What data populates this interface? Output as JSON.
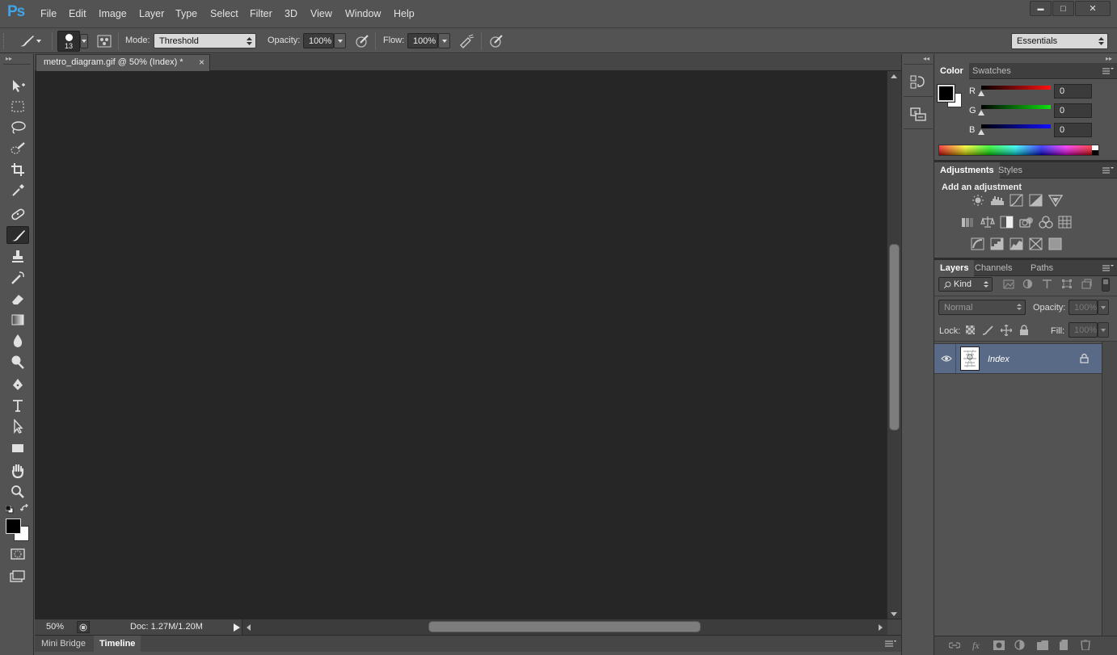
{
  "app": {
    "logo": "Ps"
  },
  "menu": [
    "File",
    "Edit",
    "Image",
    "Layer",
    "Type",
    "Select",
    "Filter",
    "3D",
    "View",
    "Window",
    "Help"
  ],
  "window_controls": {
    "minimize": "▬",
    "maximize": "□",
    "close": "✕"
  },
  "options": {
    "brush_size": "13",
    "mode_label": "Mode:",
    "mode_value": "Threshold",
    "opacity_label": "Opacity:",
    "opacity_value": "100%",
    "flow_label": "Flow:",
    "flow_value": "100%",
    "workspace": "Essentials"
  },
  "document": {
    "tab_title": "metro_diagram.gif @ 50% (Index) *",
    "tab_close": "×",
    "zoom": "50%",
    "doc_info": "Doc: 1.27M/1.20M"
  },
  "bottom_tabs": [
    "Mini Bridge",
    "Timeline"
  ],
  "color_panel": {
    "tabs": [
      "Color",
      "Swatches"
    ],
    "channels": [
      {
        "label": "R",
        "value": "0",
        "color": "#e01010"
      },
      {
        "label": "G",
        "value": "0",
        "color": "#10c010"
      },
      {
        "label": "B",
        "value": "0",
        "color": "#1010e0"
      }
    ],
    "foreground": "#000000",
    "background": "#ffffff"
  },
  "adjustments_panel": {
    "tabs": [
      "Adjustments",
      "Styles"
    ],
    "heading": "Add an adjustment"
  },
  "layers_panel": {
    "tabs": [
      "Layers",
      "Channels",
      "Paths"
    ],
    "filter_kind": "Kind",
    "blend_mode": "Normal",
    "opacity_label": "Opacity:",
    "opacity_value": "100%",
    "lock_label": "Lock:",
    "fill_label": "Fill:",
    "fill_value": "100%",
    "layers": [
      {
        "name": "Index",
        "visible": true,
        "locked": true
      }
    ]
  },
  "colors": {
    "accent": "#3fa4e8",
    "selected_layer": "#586a85",
    "canvas": "#262626",
    "chrome": "#535353"
  }
}
